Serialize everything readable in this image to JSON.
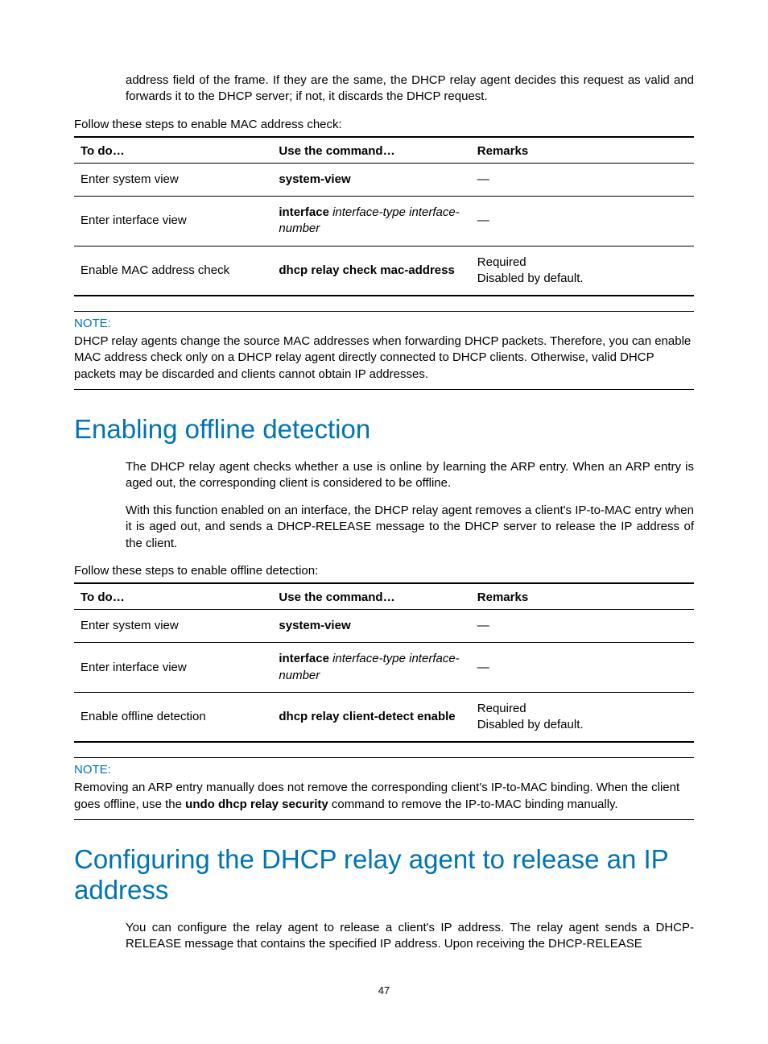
{
  "intro_para": "address field of the frame. If they are the same, the DHCP relay agent decides this request as valid and forwards it to the DHCP server; if not, it discards the DHCP request.",
  "table1_intro": "Follow these steps to enable MAC address check:",
  "table_headers": {
    "todo": "To do…",
    "cmd": "Use the command…",
    "remarks": "Remarks"
  },
  "table1": {
    "r1": {
      "todo": "Enter system view",
      "cmd_b": "system-view",
      "rem": "—"
    },
    "r2": {
      "todo": "Enter interface view",
      "cmd_b": "interface",
      "cmd_i": " interface-type interface-number",
      "rem": "—"
    },
    "r3": {
      "todo": "Enable MAC address check",
      "cmd_b": "dhcp relay check mac-address",
      "rem1": "Required",
      "rem2": "Disabled by default."
    }
  },
  "note1": {
    "label": "NOTE:",
    "text": "DHCP relay agents change the source MAC addresses when forwarding DHCP packets. Therefore, you can enable MAC address check only on a DHCP relay agent directly connected to DHCP clients. Otherwise, valid DHCP packets may be discarded and clients cannot obtain IP addresses."
  },
  "h1a": "Enabling offline detection",
  "para_a1": "The DHCP relay agent checks whether a use is online by learning the ARP entry. When an ARP entry is aged out, the corresponding client is considered to be offline.",
  "para_a2": "With this function enabled on an interface, the DHCP relay agent removes a client's IP-to-MAC entry when it is aged out, and sends a DHCP-RELEASE message to the DHCP server to release the IP address of the client.",
  "table2_intro": "Follow these steps to enable offline detection:",
  "table2": {
    "r1": {
      "todo": "Enter system view",
      "cmd_b": "system-view",
      "rem": "—"
    },
    "r2": {
      "todo": "Enter interface view",
      "cmd_b": "interface",
      "cmd_i": " interface-type interface-number",
      "rem": "—"
    },
    "r3": {
      "todo": "Enable offline detection",
      "cmd_b": "dhcp relay client-detect enable",
      "rem1": "Required",
      "rem2": "Disabled by default."
    }
  },
  "note2": {
    "label": "NOTE:",
    "pre": "Removing an ARP entry manually does not remove the corresponding client's IP-to-MAC binding. When the client goes offline, use the ",
    "bold": "undo dhcp relay security",
    "post": " command to remove the IP-to-MAC binding manually."
  },
  "h1b": "Configuring the DHCP relay agent to release an IP address",
  "para_b1": "You can configure the relay agent to release a client's IP address. The relay agent sends a DHCP-RELEASE message that contains the specified IP address. Upon receiving the DHCP-RELEASE",
  "page_num": "47"
}
